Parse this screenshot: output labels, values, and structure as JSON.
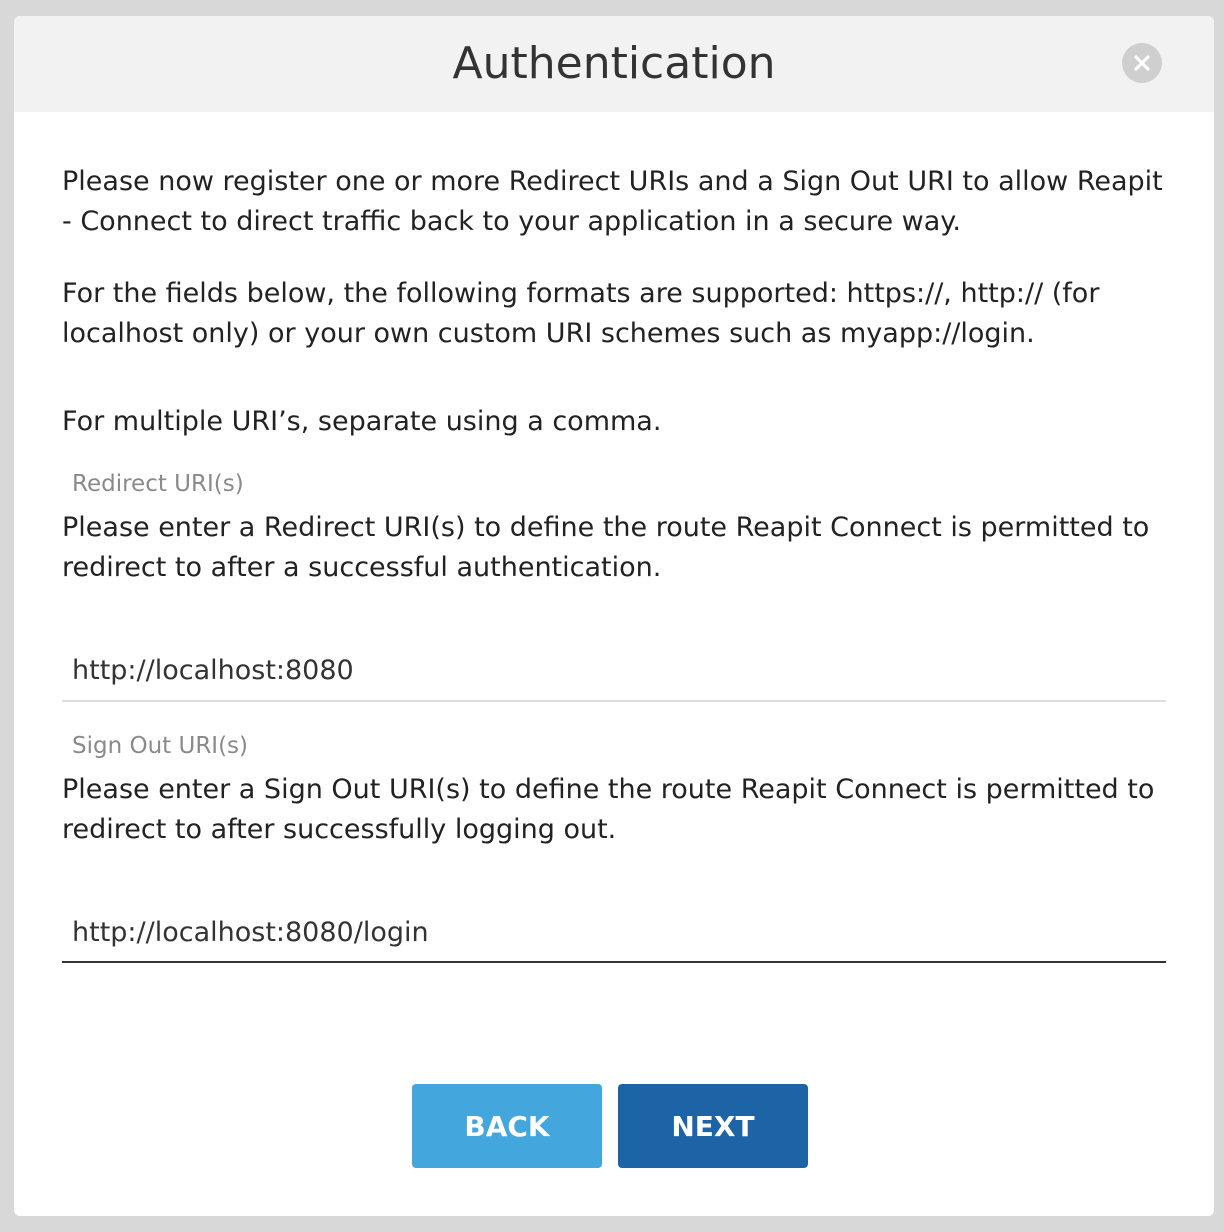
{
  "dialog": {
    "title": "Authentication",
    "close_icon": "close-icon"
  },
  "intro": {
    "paragraph1": "Please now register one or more Redirect URIs and a Sign Out URI to allow Reapit - Connect to direct traffic back to your application in a secure way.",
    "paragraph2": "For the fields below, the following formats are supported: https://, http:// (for localhost only) or your own custom URI schemes such as myapp://login.",
    "paragraph3": "For multiple URI’s, separate using a comma."
  },
  "redirect": {
    "label": "Redirect URI(s)",
    "description": "Please enter a Redirect URI(s) to define the route Reapit Connect is permitted to redirect to after a successful authentication.",
    "value": "http://localhost:8080"
  },
  "signout": {
    "label": "Sign Out URI(s)",
    "description": "Please enter a Sign Out URI(s) to define the route Reapit Connect is permitted to redirect to after successfully logging out.",
    "value": "http://localhost:8080/login"
  },
  "buttons": {
    "back_label": "BACK",
    "next_label": "NEXT"
  },
  "colors": {
    "back_button": "#43a6dd",
    "next_button": "#1d64a6",
    "header_bg": "#f2f2f2"
  }
}
